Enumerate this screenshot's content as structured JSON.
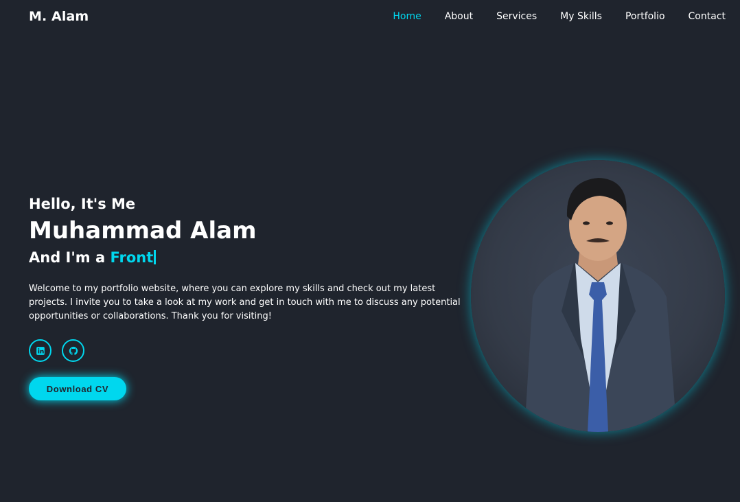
{
  "header": {
    "logo": "M. Alam",
    "nav": [
      {
        "label": "Home",
        "active": true
      },
      {
        "label": "About",
        "active": false
      },
      {
        "label": "Services",
        "active": false
      },
      {
        "label": "My Skills",
        "active": false
      },
      {
        "label": "Portfolio",
        "active": false
      },
      {
        "label": "Contact",
        "active": false
      }
    ]
  },
  "hero": {
    "greeting": "Hello, It's Me",
    "name": "Muhammad Alam",
    "role_prefix": "And I'm a ",
    "role_typed": "Front",
    "intro": "Welcome to my portfolio website, where you can explore my skills and check out my latest projects. I invite you to take a look at my work and get in touch with me to discuss any potential opportunities or collaborations. Thank you for visiting!",
    "socials": [
      {
        "icon": "linkedin-icon"
      },
      {
        "icon": "github-icon"
      }
    ],
    "cv_button": "Download CV"
  },
  "colors": {
    "background": "#1f242d",
    "accent": "#00d7ee",
    "text": "#ffffff"
  }
}
